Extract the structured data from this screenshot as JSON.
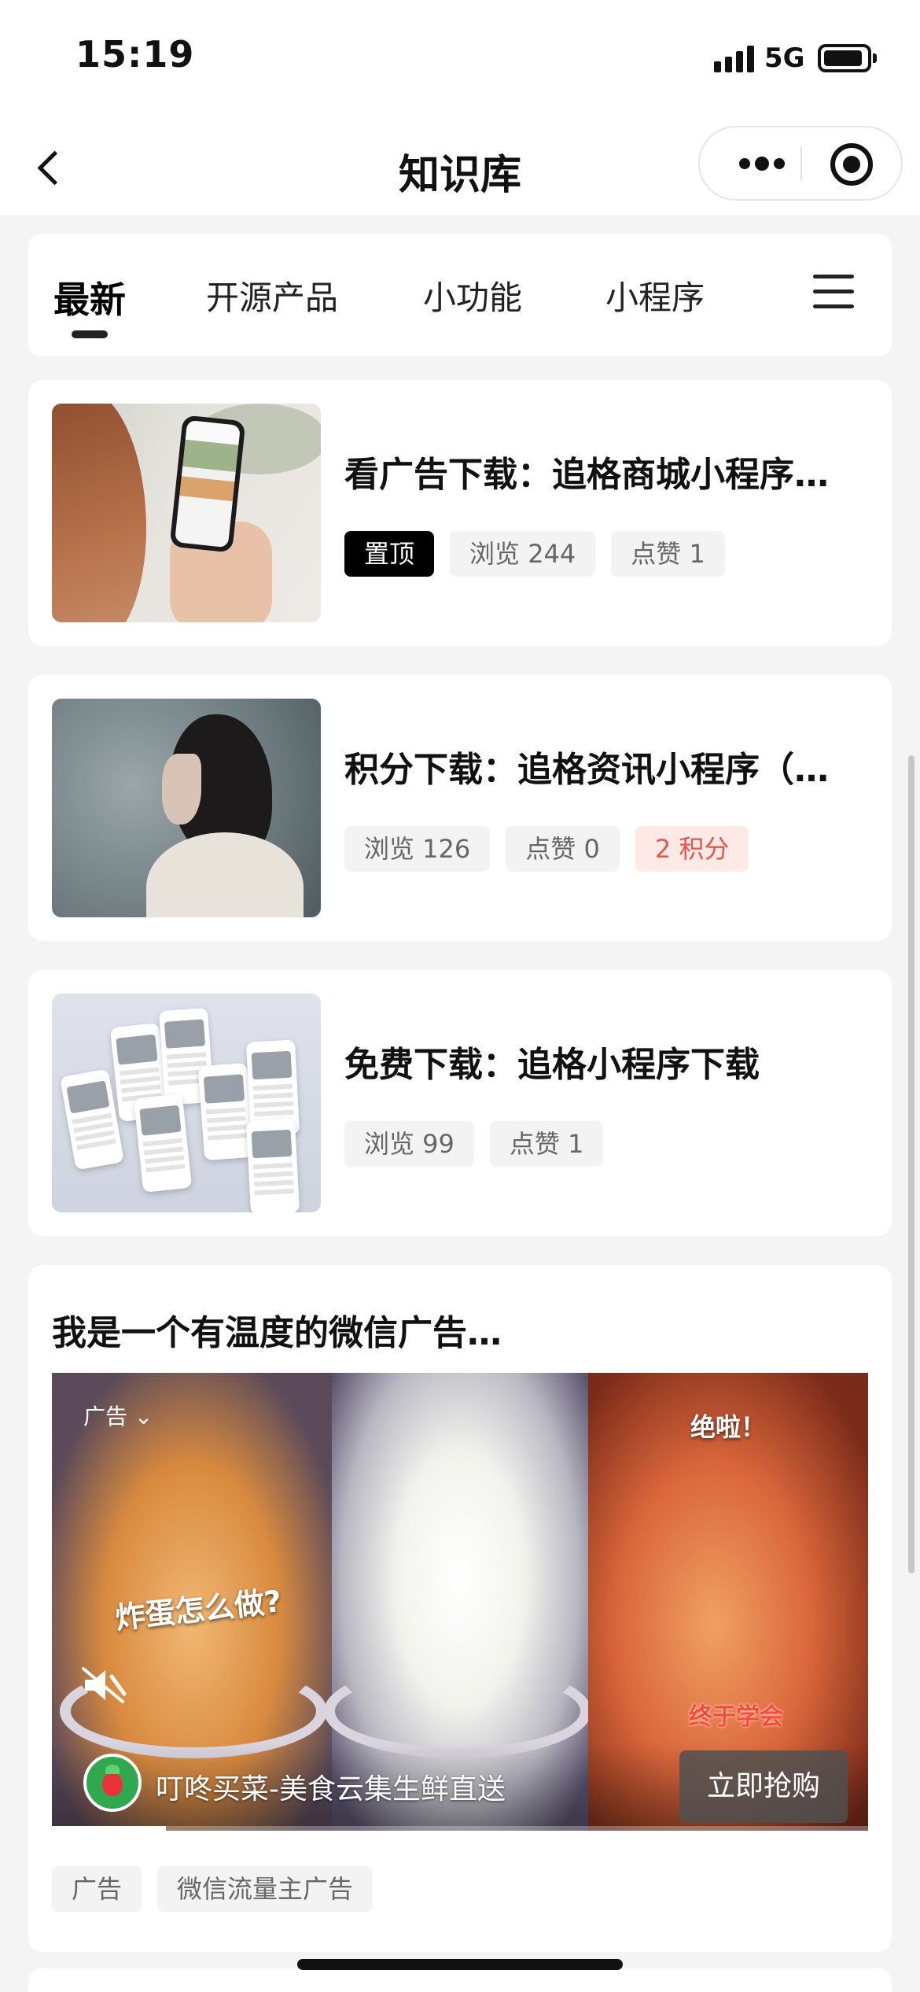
{
  "status_bar": {
    "time": "15:19",
    "network": "5G"
  },
  "nav": {
    "title": "知识库"
  },
  "tabs": [
    {
      "label": "最新",
      "active": true
    },
    {
      "label": "开源产品",
      "active": false
    },
    {
      "label": "小功能",
      "active": false
    },
    {
      "label": "小程序",
      "active": false
    }
  ],
  "articles": [
    {
      "title": "看广告下载：追格商城小程序…",
      "tags": [
        "置顶",
        "浏览 244",
        "点赞 1"
      ]
    },
    {
      "title": "积分下载：追格资讯小程序（…",
      "tags": [
        "浏览 126",
        "点赞 0",
        "2 积分"
      ]
    },
    {
      "title": "免费下载：追格小程序下载",
      "tags": [
        "浏览 99",
        "点赞 1"
      ]
    }
  ],
  "ad": {
    "title": "我是一个有温度的微信广告…",
    "label": "广告",
    "overlay_1": "炸蛋怎么做?",
    "overlay_2": "绝啦！",
    "overlay_3": "终于学会",
    "brand": "叮咚买菜-美食云集生鲜直送",
    "cta": "立即抢购",
    "progress": 0.14,
    "tags": [
      "广告",
      "微信流量主广告"
    ]
  },
  "colors": {
    "pin_bg": "#000000",
    "points_fg": "#e8554a",
    "points_bg": "#fde9e6",
    "page_bg": "#f4f4f5"
  }
}
